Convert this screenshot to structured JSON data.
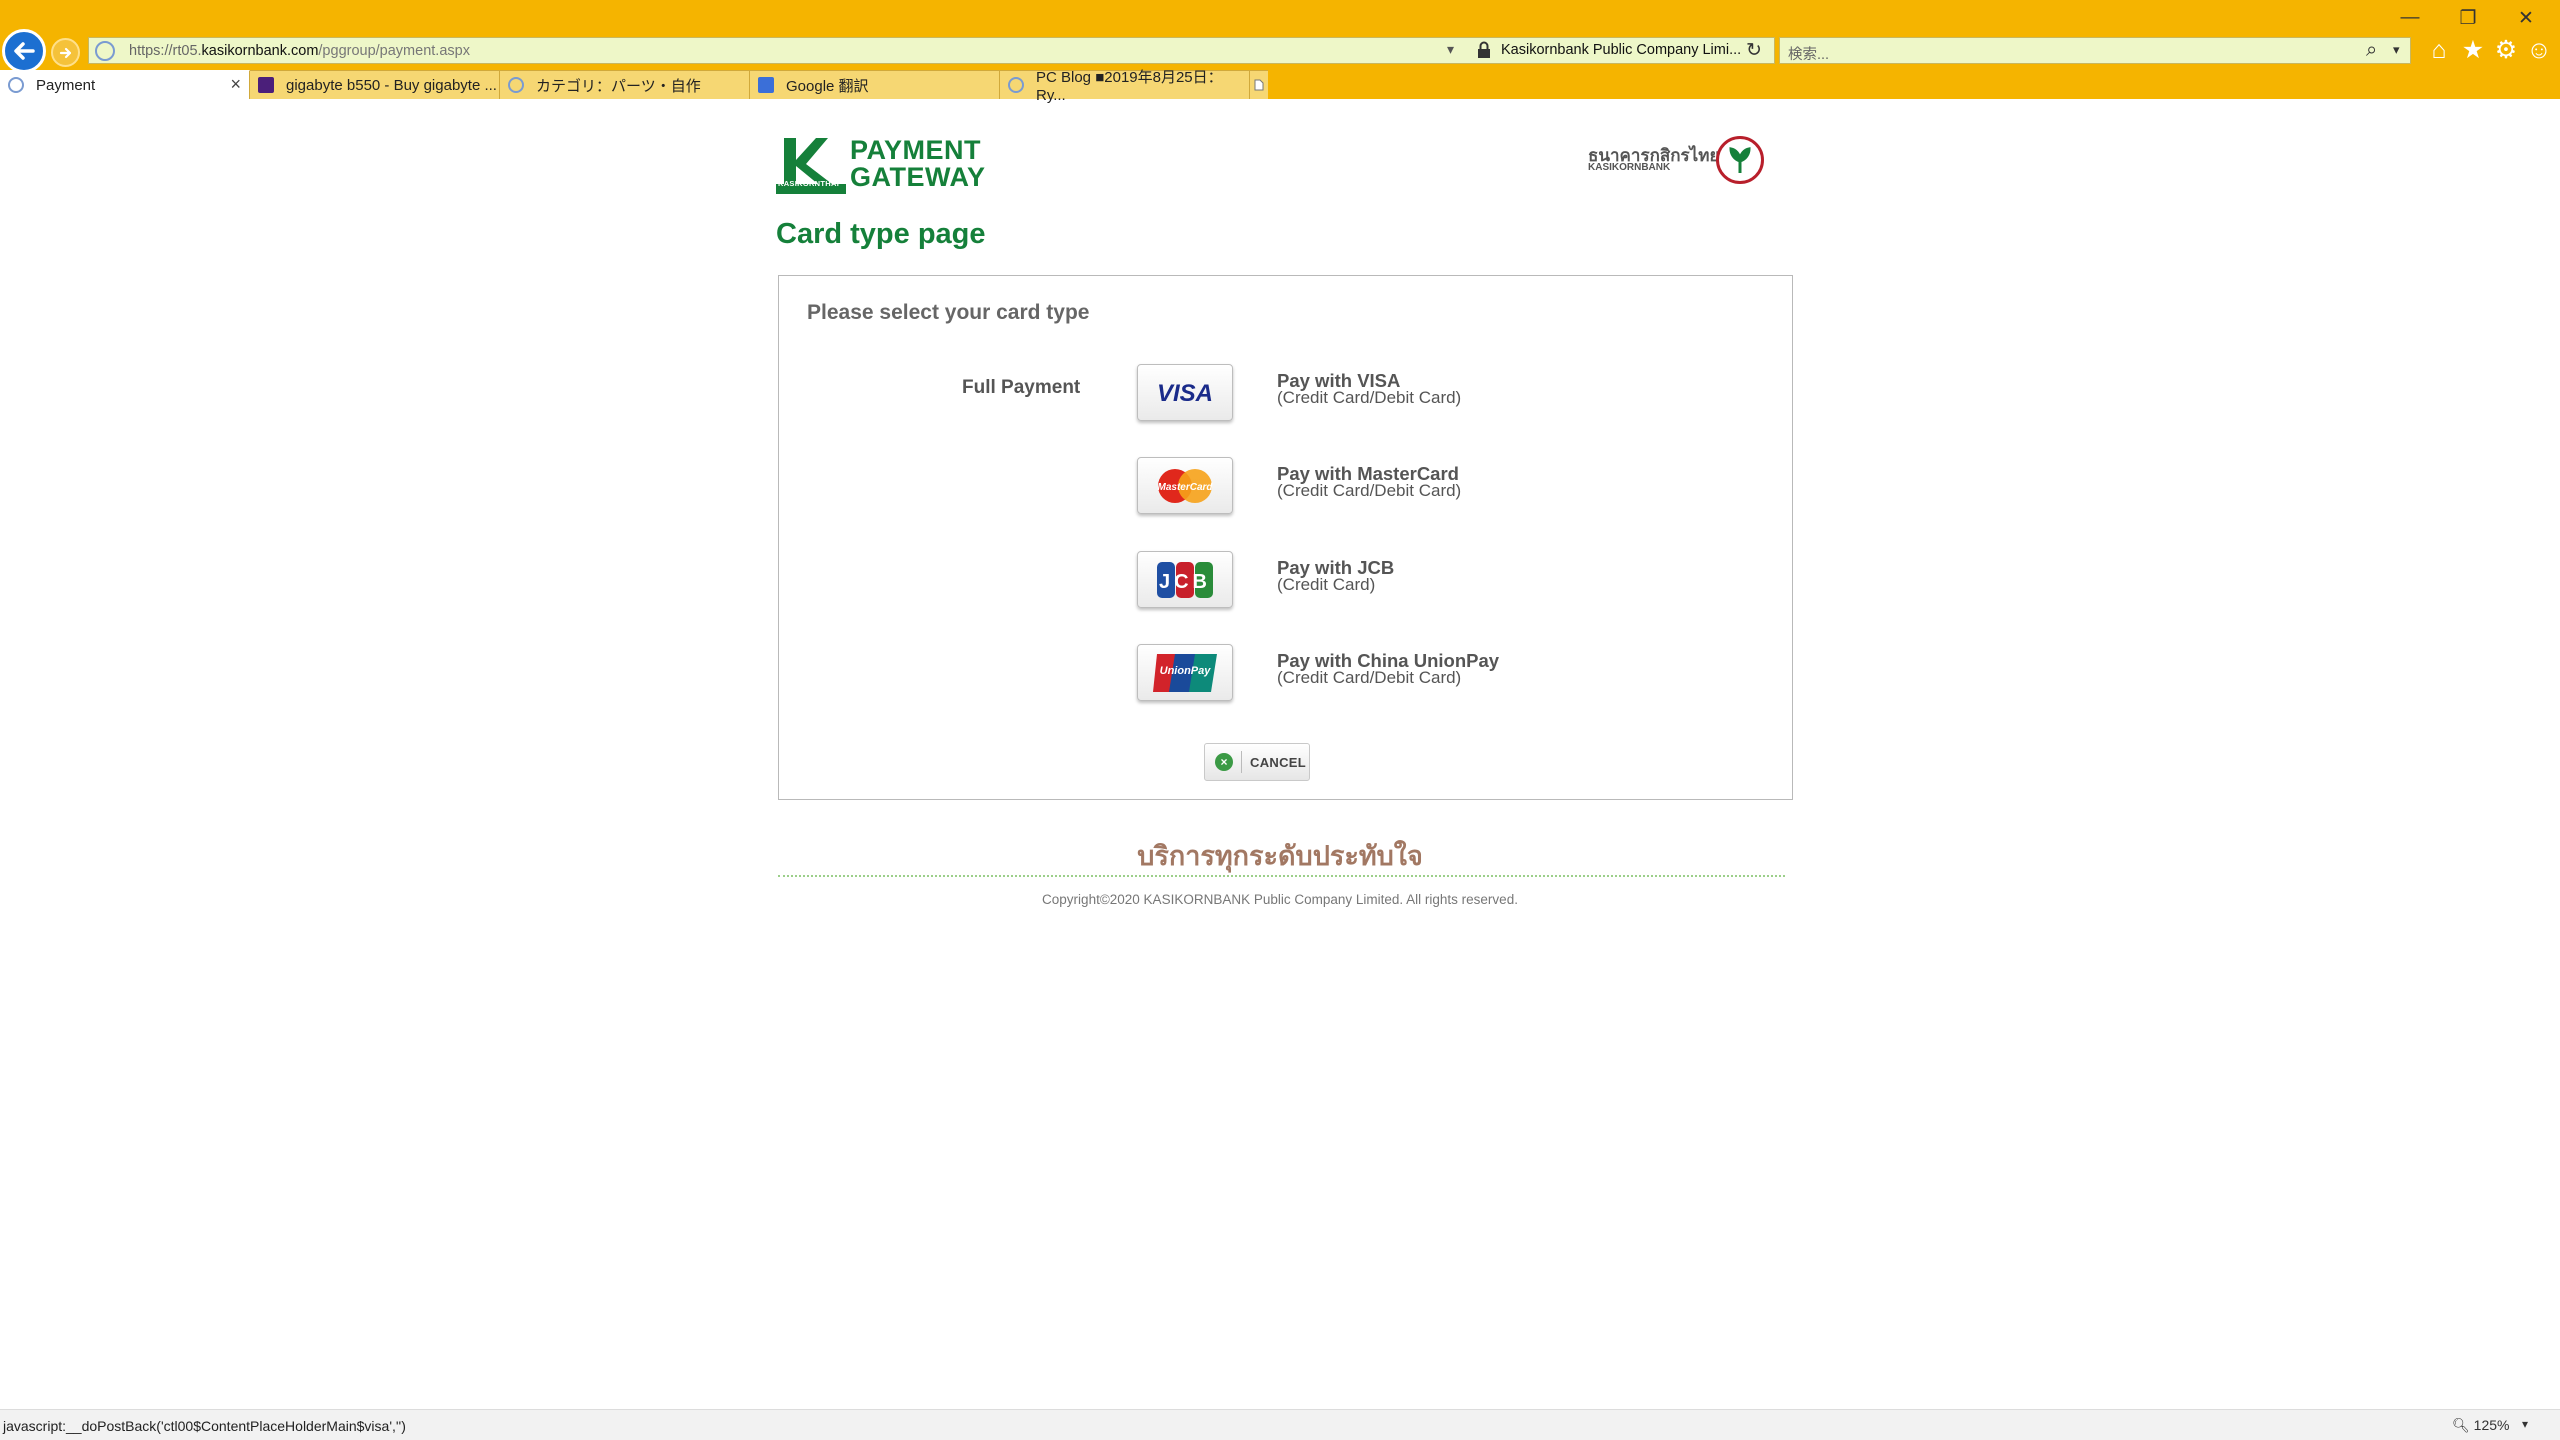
{
  "browser": {
    "window_controls": {
      "minimize": "—",
      "restore": "❐",
      "close": "✕"
    },
    "address_url_domain_prefix": "https://rt05.",
    "address_url_domain": "kasikornbank.com",
    "address_url_path": "/pggroup/payment.aspx",
    "site_identity": "Kasikornbank Public Company Limi...",
    "search_placeholder": "検索...",
    "tabs": [
      {
        "label": "Payment",
        "active": true
      },
      {
        "label": "gigabyte b550 - Buy gigabyte ...",
        "active": false
      },
      {
        "label": "カテゴリ：パーツ・自作",
        "active": false
      },
      {
        "label": "Google 翻訳",
        "active": false
      },
      {
        "label": "PC Blog ■2019年8月25日：Ry...",
        "active": false
      }
    ],
    "status_text": "javascript:__doPostBack('ctl00$ContentPlaceHolderMain$visa','')",
    "zoom": "125%"
  },
  "page": {
    "logo": {
      "line1": "PAYMENT",
      "line2": "GATEWAY",
      "small_text": "KASIKORNTHAI"
    },
    "bank_logo": {
      "thai": "ธนาคารกสิกรไทย",
      "english": "KASIKORNBANK"
    },
    "title": "Card type page",
    "panel_heading": "Please select your card type",
    "full_payment_label": "Full Payment",
    "cards": [
      {
        "title": "Pay with VISA",
        "subtitle": "(Credit Card/Debit Card)",
        "logo": "VISA"
      },
      {
        "title": "Pay with MasterCard",
        "subtitle": "(Credit Card/Debit Card)",
        "logo": "MasterCard"
      },
      {
        "title": "Pay with JCB",
        "subtitle": "(Credit Card)",
        "logo": "JCB"
      },
      {
        "title": "Pay with China UnionPay",
        "subtitle": "(Credit Card/Debit Card)",
        "logo": "UnionPay"
      }
    ],
    "cancel_label": "CANCEL",
    "slogan": "บริการทุกระดับประทับใจ",
    "copyright": "Copyright©2020 KASIKORNBANK Public Company Limited. All rights reserved."
  },
  "colors": {
    "chrome": "#f5b400",
    "brand_green": "#15803a",
    "kbank_red": "#b81f2b"
  }
}
